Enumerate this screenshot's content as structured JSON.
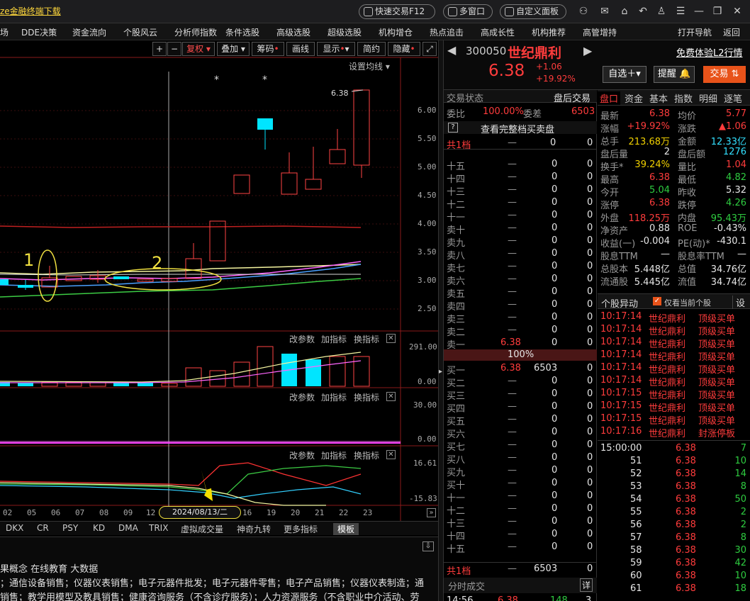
{
  "titlebar": {
    "download_link": "ze金融终端下载",
    "pills": [
      "快速交易F12",
      "多窗口",
      "自定义面板"
    ],
    "icons": [
      "user-icon",
      "mail-icon",
      "home-icon",
      "back-icon",
      "shirt-icon",
      "menu-icon",
      "minimize-icon",
      "restore-icon",
      "close-icon"
    ]
  },
  "menu": {
    "items": [
      "场",
      "DDE决策",
      "资金流向",
      "个股风云",
      "分析师指数",
      "条件选股",
      "高级选股",
      "超级选股",
      "机构增仓",
      "热点追击",
      "高成长性",
      "机构推荐",
      "高管增持"
    ],
    "right_items": [
      "打开导航",
      "返回"
    ]
  },
  "toolbar": {
    "buttons": [
      "+",
      "−",
      "复权",
      "叠加",
      "筹码",
      "画线",
      "显示",
      "简约",
      "隐藏"
    ],
    "ma_setting": "设置均线"
  },
  "kline": {
    "yticks": [
      "6.00",
      "5.50",
      "5.00",
      "4.50",
      "4.00",
      "3.50",
      "3.00",
      "2.50"
    ],
    "last_label": "6.38",
    "annotations": [
      "1",
      "2"
    ]
  },
  "panels": {
    "p1": {
      "labels": [
        "改参数",
        "加指标",
        "换指标"
      ],
      "yticks": [
        "291.00",
        "0.00"
      ]
    },
    "p2": {
      "labels": [
        "改参数",
        "加指标",
        "换指标"
      ],
      "yticks": [
        "30.00",
        "0.00"
      ]
    },
    "p3": {
      "labels": [
        "改参数",
        "加指标",
        "换指标"
      ],
      "yticks": [
        "16.61",
        "-15.83"
      ]
    }
  },
  "xaxis": {
    "ticks": [
      "02",
      "05",
      "06",
      "07",
      "08",
      "09",
      "12",
      "16",
      "19",
      "20",
      "21",
      "22",
      "23"
    ],
    "cursor_date": "2024/08/13/二"
  },
  "indicator_tabs": [
    "DKX",
    "CR",
    "PSY",
    "KD",
    "DMA",
    "TRIX",
    "虚拟成交量",
    "神奇九转",
    "更多指标",
    "模板"
  ],
  "info": {
    "line1": "果概念 在线教育 大数据",
    "line2": "；通信设备销售；仪器仪表销售；电子元器件批发；电子元器件零售；电子产品销售；仪器仪表制造；通",
    "line3": "销售；教学用模型及教具销售；健康咨询服务（不含诊疗服务）；人力资源服务（不含职业中介活动、劳"
  },
  "stock": {
    "code": "300050",
    "name": "世纪鼎利",
    "price": "6.38",
    "change": "+1.06",
    "change_pct": "+19.92%",
    "l2_link": "免费体验L2行情",
    "buttons": [
      "自选",
      "提醒",
      "交易"
    ]
  },
  "orderbook": {
    "header_left": "交易状态",
    "header_right": "盘后交易",
    "weibi_label": "委比",
    "weibi_value": "100.00%",
    "weicha_label": "委差",
    "weicha_value": "6503",
    "full_link": "查看完整档买卖盘",
    "total_sell": {
      "label": "共1档",
      "a": "—",
      "b": "0",
      "c": "0"
    },
    "sell_rows": [
      {
        "label": "十五",
        "price": "—",
        "vol": "0",
        "x": "0"
      },
      {
        "label": "十四",
        "price": "—",
        "vol": "0",
        "x": "0"
      },
      {
        "label": "十三",
        "price": "—",
        "vol": "0",
        "x": "0"
      },
      {
        "label": "十二",
        "price": "—",
        "vol": "0",
        "x": "0"
      },
      {
        "label": "十一",
        "price": "—",
        "vol": "0",
        "x": "0"
      },
      {
        "label": "卖十",
        "price": "—",
        "vol": "0",
        "x": "0"
      },
      {
        "label": "卖九",
        "price": "—",
        "vol": "0",
        "x": "0"
      },
      {
        "label": "卖八",
        "price": "—",
        "vol": "0",
        "x": "0"
      },
      {
        "label": "卖七",
        "price": "—",
        "vol": "0",
        "x": "0"
      },
      {
        "label": "卖六",
        "price": "—",
        "vol": "0",
        "x": "0"
      },
      {
        "label": "卖五",
        "price": "—",
        "vol": "0",
        "x": "0"
      },
      {
        "label": "卖四",
        "price": "—",
        "vol": "0",
        "x": "0"
      },
      {
        "label": "卖三",
        "price": "—",
        "vol": "0",
        "x": "0"
      },
      {
        "label": "卖二",
        "price": "—",
        "vol": "0",
        "x": "0"
      },
      {
        "label": "卖一",
        "price": "6.38",
        "vol": "0",
        "x": "0"
      }
    ],
    "ratio": "100%",
    "buy_rows": [
      {
        "label": "买一",
        "price": "6.38",
        "vol": "6503",
        "x": "0"
      },
      {
        "label": "买二",
        "price": "—",
        "vol": "0",
        "x": "0"
      },
      {
        "label": "买三",
        "price": "—",
        "vol": "0",
        "x": "0"
      },
      {
        "label": "买四",
        "price": "—",
        "vol": "0",
        "x": "0"
      },
      {
        "label": "买五",
        "price": "—",
        "vol": "0",
        "x": "0"
      },
      {
        "label": "买六",
        "price": "—",
        "vol": "0",
        "x": "0"
      },
      {
        "label": "买七",
        "price": "—",
        "vol": "0",
        "x": "0"
      },
      {
        "label": "买八",
        "price": "—",
        "vol": "0",
        "x": "0"
      },
      {
        "label": "买九",
        "price": "—",
        "vol": "0",
        "x": "0"
      },
      {
        "label": "买十",
        "price": "—",
        "vol": "0",
        "x": "0"
      },
      {
        "label": "十一",
        "price": "—",
        "vol": "0",
        "x": "0"
      },
      {
        "label": "十二",
        "price": "—",
        "vol": "0",
        "x": "0"
      },
      {
        "label": "十三",
        "price": "—",
        "vol": "0",
        "x": "0"
      },
      {
        "label": "十四",
        "price": "—",
        "vol": "0",
        "x": "0"
      },
      {
        "label": "十五",
        "price": "—",
        "vol": "0",
        "x": "0"
      }
    ],
    "total_buy": {
      "label": "共1档",
      "a": "—",
      "b": "6503",
      "c": "0"
    },
    "fenshi_label": "分时成交",
    "fenshi_btn": "详",
    "last_trade": {
      "time": "14:56",
      "price": "6.38",
      "vol": "148",
      "n": "3"
    }
  },
  "quote": {
    "tabs": [
      "盘口",
      "资金",
      "基本",
      "指数",
      "明细",
      "逐笔"
    ],
    "rows": [
      {
        "l1": "最新",
        "v1": "6.38",
        "c1": "red",
        "l2": "均价",
        "v2": "5.77",
        "c2": "red"
      },
      {
        "l1": "涨幅",
        "v1": "+19.92%",
        "c1": "red",
        "l2": "涨跌",
        "v2": "▲1.06",
        "c2": "red"
      },
      {
        "l1": "总手",
        "v1": "213.68万",
        "c1": "yellow",
        "l2": "金额",
        "v2": "12.33亿",
        "c2": "cyan"
      },
      {
        "l1": "盘后量",
        "v1": "2",
        "c1": "white",
        "l2": "盘后额",
        "v2": "1276",
        "c2": "cyan"
      },
      {
        "l1": "换手*",
        "v1": "39.24%",
        "c1": "yellow",
        "l2": "量比",
        "v2": "1.04",
        "c2": "red"
      },
      {
        "l1": "最高",
        "v1": "6.38",
        "c1": "red",
        "l2": "最低",
        "v2": "4.82",
        "c2": "green"
      },
      {
        "l1": "今开",
        "v1": "5.04",
        "c1": "green",
        "l2": "昨收",
        "v2": "5.32",
        "c2": "white"
      },
      {
        "l1": "涨停",
        "v1": "6.38",
        "c1": "red",
        "l2": "跌停",
        "v2": "4.26",
        "c2": "green"
      },
      {
        "l1": "外盘",
        "v1": "118.25万",
        "c1": "red",
        "l2": "内盘",
        "v2": "95.43万",
        "c2": "green"
      },
      {
        "l1": "净资产",
        "v1": "0.88",
        "c1": "white",
        "l2": "ROE",
        "v2": "-0.43%",
        "c2": "white"
      },
      {
        "l1": "收益(一)",
        "v1": "-0.004",
        "c1": "white",
        "l2": "PE(动)*",
        "v2": "-430.1",
        "c2": "white"
      },
      {
        "l1": "股息TTM",
        "v1": "—",
        "c1": "white",
        "l2": "股息率TTM",
        "v2": "—",
        "c2": "white"
      },
      {
        "l1": "总股本",
        "v1": "5.448亿",
        "c1": "white",
        "l2": "总值",
        "v2": "34.76亿",
        "c2": "white"
      },
      {
        "l1": "流通股",
        "v1": "5.445亿",
        "c1": "white",
        "l2": "流值",
        "v2": "34.74亿",
        "c2": "white"
      }
    ],
    "yidong_title": "个股异动",
    "yidong_check": "仅看当前个股",
    "yidong_btn": "设",
    "alerts": [
      {
        "t": "10:17:14",
        "n": "世纪鼎利",
        "e": "顶级买单"
      },
      {
        "t": "10:17:14",
        "n": "世纪鼎利",
        "e": "顶级买单"
      },
      {
        "t": "10:17:14",
        "n": "世纪鼎利",
        "e": "顶级买单"
      },
      {
        "t": "10:17:14",
        "n": "世纪鼎利",
        "e": "顶级买单"
      },
      {
        "t": "10:17:14",
        "n": "世纪鼎利",
        "e": "顶级买单"
      },
      {
        "t": "10:17:14",
        "n": "世纪鼎利",
        "e": "顶级买单"
      },
      {
        "t": "10:17:15",
        "n": "世纪鼎利",
        "e": "顶级买单"
      },
      {
        "t": "10:17:15",
        "n": "世纪鼎利",
        "e": "顶级买单"
      },
      {
        "t": "10:17:15",
        "n": "世纪鼎利",
        "e": "顶级买单"
      },
      {
        "t": "10:17:16",
        "n": "世纪鼎利",
        "e": "封涨停板"
      }
    ],
    "ticks": [
      {
        "t": "15:00:00",
        "p": "6.38",
        "v": "7"
      },
      {
        "t": "51",
        "p": "6.38",
        "v": "10"
      },
      {
        "t": "52",
        "p": "6.38",
        "v": "14"
      },
      {
        "t": "53",
        "p": "6.38",
        "v": "8"
      },
      {
        "t": "54",
        "p": "6.38",
        "v": "50"
      },
      {
        "t": "55",
        "p": "6.38",
        "v": "2"
      },
      {
        "t": "56",
        "p": "6.38",
        "v": "2"
      },
      {
        "t": "57",
        "p": "6.38",
        "v": "8"
      },
      {
        "t": "58",
        "p": "6.38",
        "v": "30"
      },
      {
        "t": "59",
        "p": "6.38",
        "v": "42"
      },
      {
        "t": "60",
        "p": "6.38",
        "v": "10"
      },
      {
        "t": "61",
        "p": "6.38",
        "v": "18"
      }
    ]
  }
}
